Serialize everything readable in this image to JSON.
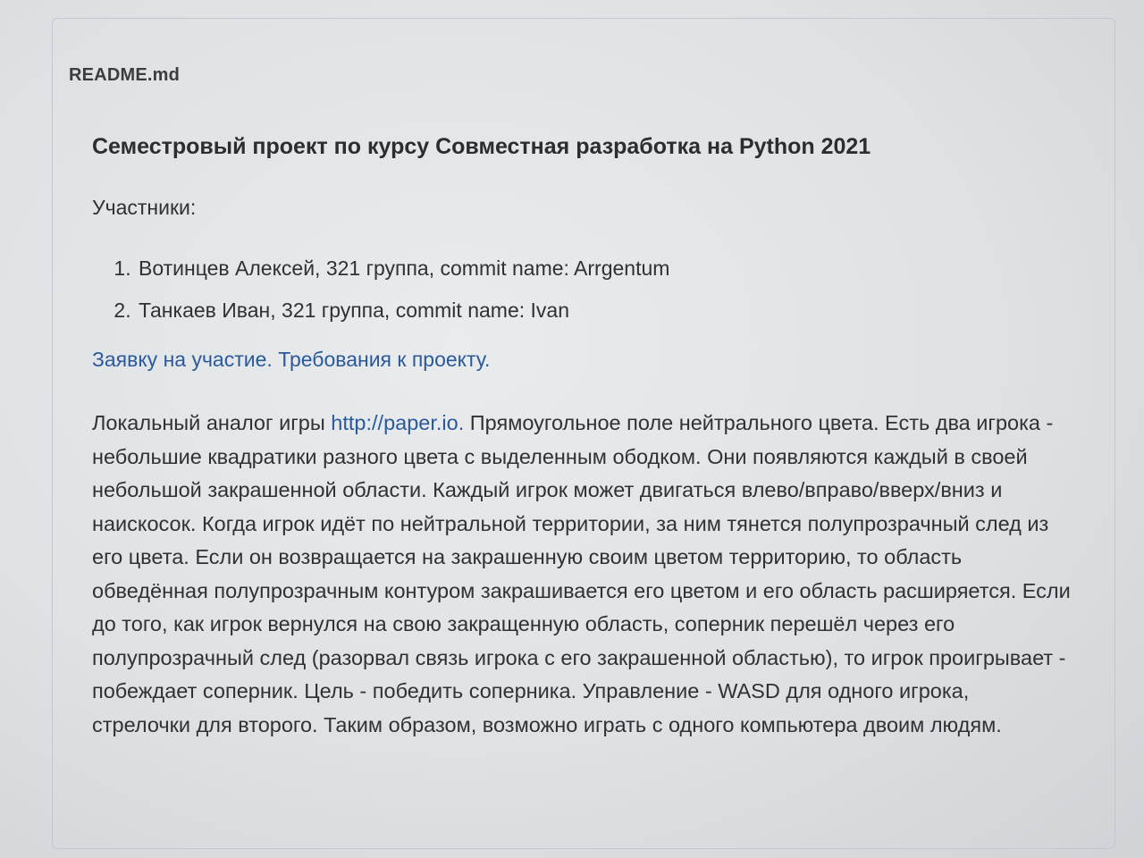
{
  "readme": {
    "file_name": "README.md",
    "title": "Семестровый проект по курсу Совместная разработка на Python 2021",
    "members_label": "Участники:",
    "members": [
      "Вотинцев Алексей, 321 группа, commit name: Arrgentum",
      "Танкаев Иван, 321 группа, commit name: Ivan"
    ],
    "links": {
      "application": "Заявку на участие.",
      "requirements": "Требования к проекту."
    },
    "description": {
      "prefix": "Локальный аналог игры ",
      "link": "http://paper.io.",
      "text": " Прямоугольное поле нейтрального цвета. Есть два игрока - небольшие квадратики разного цвета с выделенным ободком. Они появляются каждый в своей небольшой закрашенной области. Каждый игрок может двигаться влево/вправо/вверх/вниз и наискосок. Когда игрок идёт по нейтральной территории, за ним тянется полупрозрачный след из его цвета. Если он возвращается на закрашенную своим цветом территорию, то область обведённая полупрозрачным контуром закрашивается его цветом и его область расширяется. Если до того, как игрок вернулся на свою закращенную область, соперник перешёл через его полупрозрачный след (разорвал связь игрока с его закрашенной областью), то игрок проигрывает - побеждает соперник. Цель - победить соперника. Управление - WASD для одного игрока, стрелочки для второго. Таким образом, возможно играть с одного компьютера двоим людям."
    }
  },
  "colors": {
    "link": "#2a5a9c",
    "text": "#2f3235",
    "background": "#e4e6e8"
  }
}
